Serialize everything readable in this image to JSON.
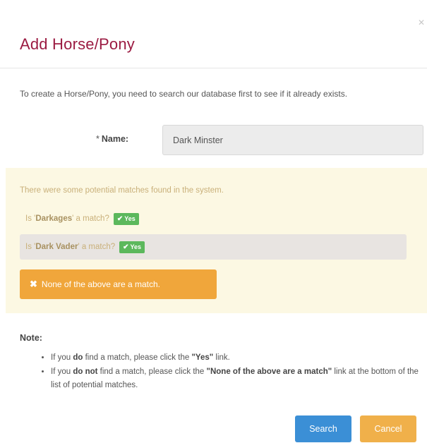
{
  "modal": {
    "title": "Add Horse/Pony",
    "close_icon": "close-icon",
    "intro": "To create a Horse/Pony, you need to search our database first to see if it already exists."
  },
  "form": {
    "required_marker": "*",
    "name_label": "Name:",
    "name_value": "Dark Minster"
  },
  "matches": {
    "message": "There were some potential matches found in the system.",
    "items": [
      {
        "prefix": "Is '",
        "name": "Darkages",
        "suffix": "' a match?",
        "yes_label": "Yes"
      },
      {
        "prefix": "Is '",
        "name": "Dark Vader",
        "suffix": "' a match?",
        "yes_label": "Yes"
      }
    ],
    "none_label": "None of the above are a match."
  },
  "note": {
    "heading": "Note:",
    "items": [
      {
        "t1": "If you ",
        "b1": "do",
        "t2": " find a match, please click the ",
        "b2": "\"Yes\"",
        "t3": " link."
      },
      {
        "t1": "If you ",
        "b1": "do not",
        "t2": " find a match, please click the ",
        "b2": "\"None of the above are a match\"",
        "t3": " link at the bottom of the list of potential matches."
      }
    ]
  },
  "footer": {
    "search_label": "Search",
    "cancel_label": "Cancel"
  },
  "colors": {
    "title": "#9b1b42",
    "warning_bg": "#fcf8e3",
    "success": "#5cb85c",
    "orange": "#f0a63b",
    "primary": "#3b8fd6"
  }
}
